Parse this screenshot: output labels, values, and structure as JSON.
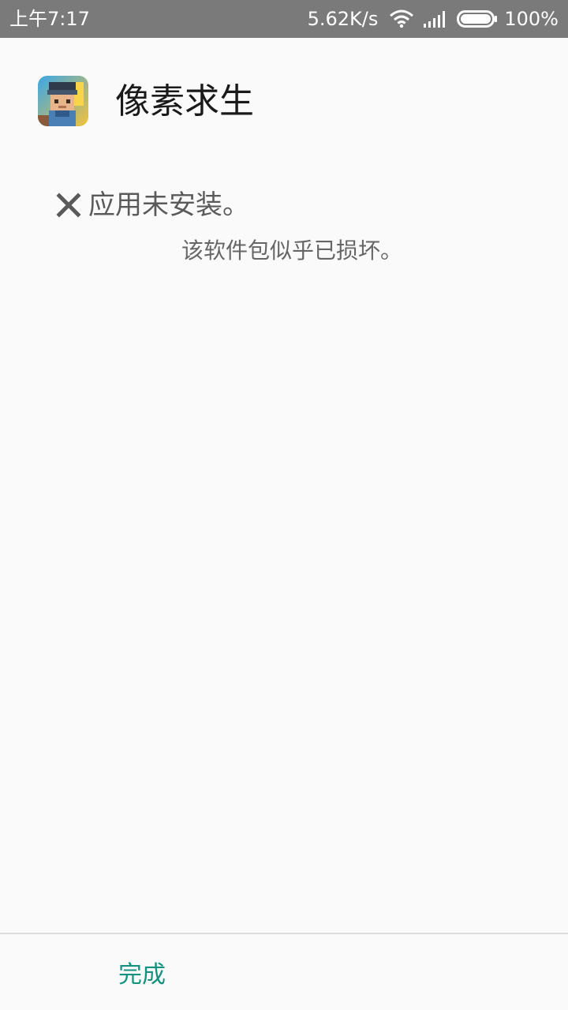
{
  "status_bar": {
    "time": "上午7:17",
    "net_speed": "5.62K/s",
    "battery_percent": "100%",
    "wifi_icon": "wifi-icon",
    "signal_icon": "cellular-signal-icon",
    "battery_icon": "battery-icon",
    "battery_level": 1.0
  },
  "app": {
    "name": "像素求生",
    "icon": "app-icon"
  },
  "result": {
    "icon": "close-x-icon",
    "message": "应用未安装。",
    "detail": "该软件包似乎已损坏。"
  },
  "footer": {
    "done_label": "完成"
  },
  "colors": {
    "status_bar_bg": "#7a7a7a",
    "accent": "#14917f",
    "background": "#fafafa"
  }
}
